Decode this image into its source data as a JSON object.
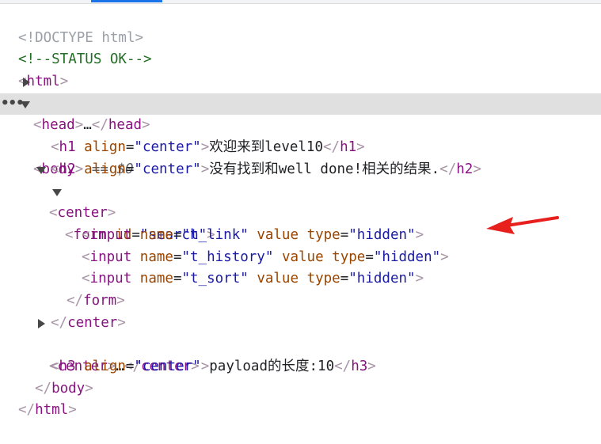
{
  "doctype": "<!DOCTYPE html>",
  "comment": "<!--STATUS OK-->",
  "html_tag": "html",
  "head": {
    "tag": "head",
    "ellipsis": "…"
  },
  "body": {
    "tag": "body",
    "sel_marker": "== $0",
    "ellipsis_dots": "•••"
  },
  "h1": {
    "tag": "h1",
    "attr": "align",
    "value": "\"center\"",
    "text": "欢迎来到level10"
  },
  "h2": {
    "tag": "h2",
    "attr": "align",
    "value": "\"center\"",
    "text": "没有找到和well done!相关的结果."
  },
  "center1": {
    "tag": "center"
  },
  "form": {
    "tag": "form",
    "attr": "id",
    "value": "\"search\""
  },
  "inputs": [
    {
      "tag": "input",
      "name_attr": "name",
      "name_val": "\"t_link\"",
      "value_attr": "value",
      "type_attr": "type",
      "type_val": "\"hidden\""
    },
    {
      "tag": "input",
      "name_attr": "name",
      "name_val": "\"t_history\"",
      "value_attr": "value",
      "type_attr": "type",
      "type_val": "\"hidden\""
    },
    {
      "tag": "input",
      "name_attr": "name",
      "name_val": "\"t_sort\"",
      "value_attr": "value",
      "type_attr": "type",
      "type_val": "\"hidden\""
    }
  ],
  "center2": {
    "tag": "center",
    "ellipsis": "…"
  },
  "h3": {
    "tag": "h3",
    "attr": "align",
    "value": "\"center\"",
    "text": "payload的长度:10"
  },
  "colors": {
    "annotation_arrow": "#e8201d",
    "selection": "#e0e0e0"
  }
}
